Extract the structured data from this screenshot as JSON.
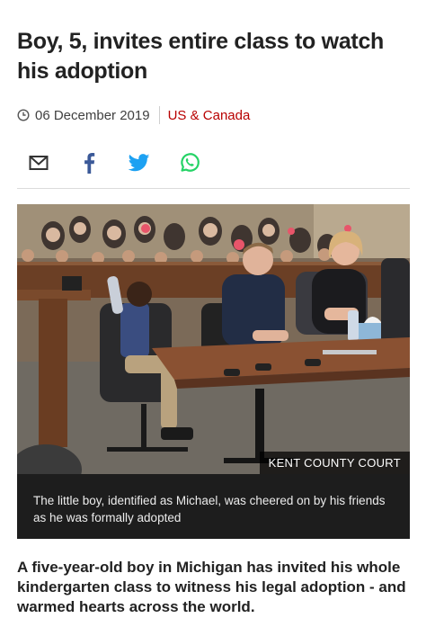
{
  "article": {
    "headline": "Boy, 5, invites entire class to watch his adoption",
    "date": "06 December 2019",
    "category": "US & Canada",
    "share_icons": [
      "email-icon",
      "facebook-icon",
      "twitter-icon",
      "whatsapp-icon"
    ],
    "image_copyright": "KENT COUNTY COURT",
    "image_caption": "The little boy, identified as Michael, was cheered on by his friends as he was formally adopted",
    "summary": "A five-year-old boy in Michigan has invited his whole kindergarten class to witness his legal adoption - and warmed hearts across the world."
  },
  "colors": {
    "category": "#b80000",
    "facebook": "#3b5998",
    "twitter": "#1da1f2",
    "whatsapp": "#25d366",
    "caption_bg": "#1d1d1d"
  }
}
